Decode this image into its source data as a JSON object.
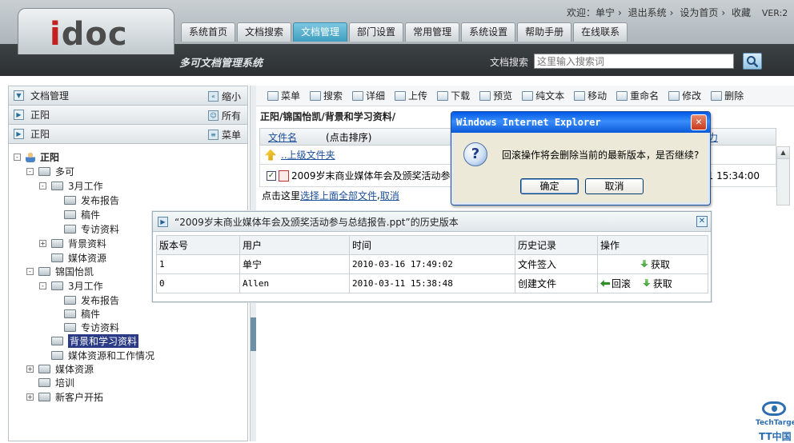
{
  "app": {
    "logo": "idoc",
    "subtitle": "多可文档管理系统"
  },
  "topbar": {
    "welcome": "欢迎：单宁",
    "logout": "退出系统",
    "set_home": "设为首页",
    "favorite": "收藏",
    "version": "VER:2"
  },
  "nav": {
    "tabs": [
      "系统首页",
      "文档搜索",
      "文档管理",
      "部门设置",
      "常用管理",
      "系统设置",
      "帮助手册",
      "在线联系"
    ],
    "active": "文档管理"
  },
  "search": {
    "label": "文档搜索",
    "placeholder": "这里输入搜索词"
  },
  "left": {
    "header": "文档管理",
    "collapse": "缩小",
    "row2": "正阳",
    "row2_right": "所有",
    "row3": "正阳",
    "row3_right": "菜单",
    "tree": [
      {
        "label": "正阳",
        "pm": "-",
        "bold": true
      },
      {
        "label": "多可",
        "pm": "-"
      },
      {
        "label": "3月工作",
        "pm": "-"
      },
      {
        "label": "发布报告"
      },
      {
        "label": "稿件"
      },
      {
        "label": "专访资料"
      },
      {
        "label": "背景资料",
        "pm": "+"
      },
      {
        "label": "媒体资源"
      },
      {
        "label": "锦国怡凯",
        "pm": "-"
      },
      {
        "label": "3月工作",
        "pm": "-"
      },
      {
        "label": "发布报告"
      },
      {
        "label": "稿件"
      },
      {
        "label": "专访资料"
      },
      {
        "label": "背景和学习资料",
        "selected": true
      },
      {
        "label": "媒体资源和工作情况"
      },
      {
        "label": "媒体资源",
        "pm": "+"
      },
      {
        "label": "培训"
      },
      {
        "label": "新客户开拓",
        "pm": "+"
      }
    ]
  },
  "toolbar": {
    "items": [
      "菜单",
      "搜索",
      "详细",
      "上传",
      "下载",
      "预览",
      "纯文本",
      "移动",
      "重命名",
      "修改",
      "删除"
    ]
  },
  "main": {
    "breadcrumb": "正阳/锦国怡凯/背景和学习资料/",
    "col_filename": "文件名",
    "sort_hint": "(点击排序)",
    "col_right_partial": "力",
    "parent_folder": "..上级文件夹",
    "file_name": "2009岁末商业媒体年会及颁奖活动参与",
    "file_time": "1 15:34:00",
    "select_prefix": "点击这里",
    "select_all": "选择上面全部文件",
    "cancel": "取消"
  },
  "history": {
    "title": "“2009岁末商业媒体年会及颁奖活动参与总结报告.ppt”的历史版本",
    "columns": [
      "版本号",
      "用户",
      "时间",
      "历史记录",
      "操作"
    ],
    "rows": [
      {
        "version": "1",
        "user": "单宁",
        "time": "2010-03-16 17:49:02",
        "record": "文件签入",
        "ops": [
          "获取"
        ]
      },
      {
        "version": "0",
        "user": "Allen",
        "time": "2010-03-11 15:38:48",
        "record": "创建文件",
        "ops": [
          "回滚",
          "获取"
        ]
      }
    ]
  },
  "dialog": {
    "title": "Windows Internet Explorer",
    "message": "回滚操作将会删除当前的最新版本，是否继续?",
    "ok": "确定",
    "cancel": "取消"
  },
  "watermark": {
    "line1": "TechTarget",
    "line2": "TT中国"
  }
}
